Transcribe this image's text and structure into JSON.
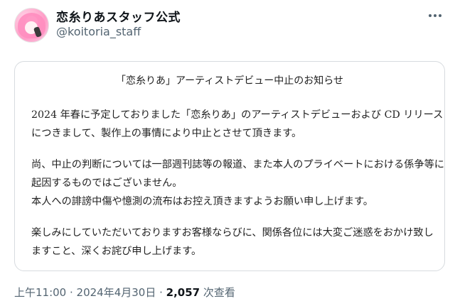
{
  "account": {
    "display_name": "恋糸りあスタッフ公式",
    "handle": "@koitoria_staff",
    "more_icon": "more-horizontal-icon"
  },
  "notice": {
    "title": "「恋糸りあ」アーティストデビュー中止のお知らせ",
    "paragraph1": [
      "2024 年春に予定しておりました「恋糸りあ」のアーティストデビューおよび CD リリース",
      "につきまして、製作上の事情により中止とさせて頂きます。"
    ],
    "paragraph2": [
      "尚、中止の判断については一部週刊誌等の報道、また本人のプライベートにおける係争等に",
      "起因するものではございません。",
      "本人への誹謗中傷や憶測の流布はお控え頂きますようお願い申し上げます。"
    ],
    "paragraph3": [
      "楽しみにしていただいておりますお客様ならびに、関係各位には大変ご迷惑をおかけ致し",
      "ますこと、深くお詫び申し上げます。"
    ]
  },
  "meta": {
    "time": "上午11:00",
    "sep1": " · ",
    "date": "2024年4月30日",
    "sep2": " · ",
    "views_count": "2,057",
    "views_label": " 次查看"
  }
}
